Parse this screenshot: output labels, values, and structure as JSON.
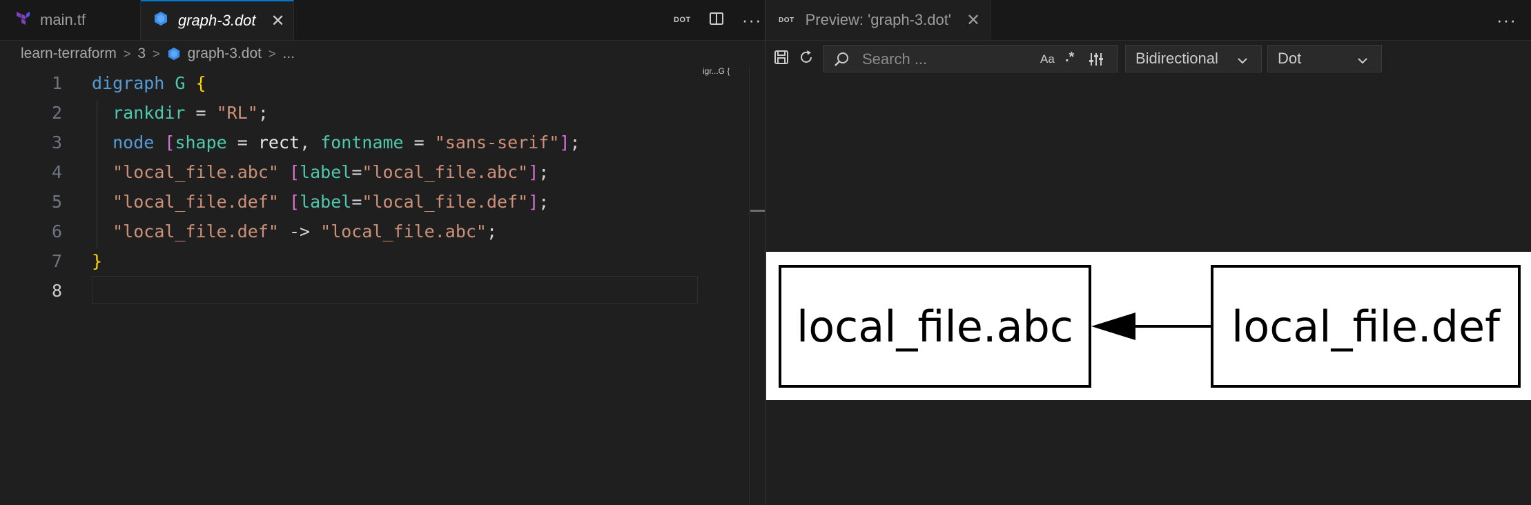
{
  "editor": {
    "tabs": [
      {
        "label": "main.tf",
        "active": false
      },
      {
        "label": "graph-3.dot",
        "active": true
      }
    ],
    "actions": {
      "dot_badge": "DOT"
    },
    "breadcrumb": [
      "learn-terraform",
      "3",
      "graph-3.dot",
      "..."
    ],
    "lines": [
      {
        "number": "1"
      },
      {
        "number": "2"
      },
      {
        "number": "3"
      },
      {
        "number": "4"
      },
      {
        "number": "5"
      },
      {
        "number": "6"
      },
      {
        "number": "7"
      },
      {
        "number": "8"
      }
    ],
    "code": {
      "l1_kw": "digraph",
      "l1_name": " G ",
      "l1_brace": "{",
      "l2_key": "rankdir",
      "l2_eq": " = ",
      "l2_val": "\"RL\"",
      "l2_end": ";",
      "l3_kw": "node",
      "l3_sp": " ",
      "l3_open": "[",
      "l3_attr1": "shape",
      "l3_eq1": " = ",
      "l3_val1": "rect",
      "l3_comma": ", ",
      "l3_attr2": "fontname",
      "l3_eq2": " = ",
      "l3_val2": "\"sans-serif\"",
      "l3_close": "]",
      "l3_end": ";",
      "l4_id": "\"local_file.abc\"",
      "l4_sp": " ",
      "l4_open": "[",
      "l4_attr": "label",
      "l4_eq": "=",
      "l4_val": "\"local_file.abc\"",
      "l4_close": "]",
      "l4_end": ";",
      "l5_id": "\"local_file.def\"",
      "l5_sp": " ",
      "l5_open": "[",
      "l5_attr": "label",
      "l5_eq": "=",
      "l5_val": "\"local_file.def\"",
      "l5_close": "]",
      "l5_end": ";",
      "l6_from": "\"local_file.def\"",
      "l6_arrow": " -> ",
      "l6_to": "\"local_file.abc\"",
      "l6_end": ";",
      "l7_brace": "}"
    },
    "minimap_text": "igr...G {"
  },
  "preview": {
    "tab_badge": "DOT",
    "tab_label": "Preview: 'graph-3.dot'",
    "search": {
      "placeholder": "Search ..."
    },
    "options": {
      "match_case": "Aa",
      "regex": ".*"
    },
    "direction_select": "Bidirectional",
    "engine_select": "Dot",
    "graph": {
      "nodes": [
        {
          "id": "local_file.abc",
          "label": "local_file.abc"
        },
        {
          "id": "local_file.def",
          "label": "local_file.def"
        }
      ],
      "edges": [
        {
          "from": "local_file.def",
          "to": "local_file.abc"
        }
      ],
      "rankdir": "RL"
    }
  },
  "colors": {
    "background": "#1f1f1f",
    "tab_active_border": "#0078d4",
    "keyword": "#569cd6",
    "string": "#ce9178",
    "attribute": "#9cdcfe",
    "type": "#4ec9b0",
    "bracket_gold": "#ffd700",
    "bracket_blue": "#179fff"
  }
}
